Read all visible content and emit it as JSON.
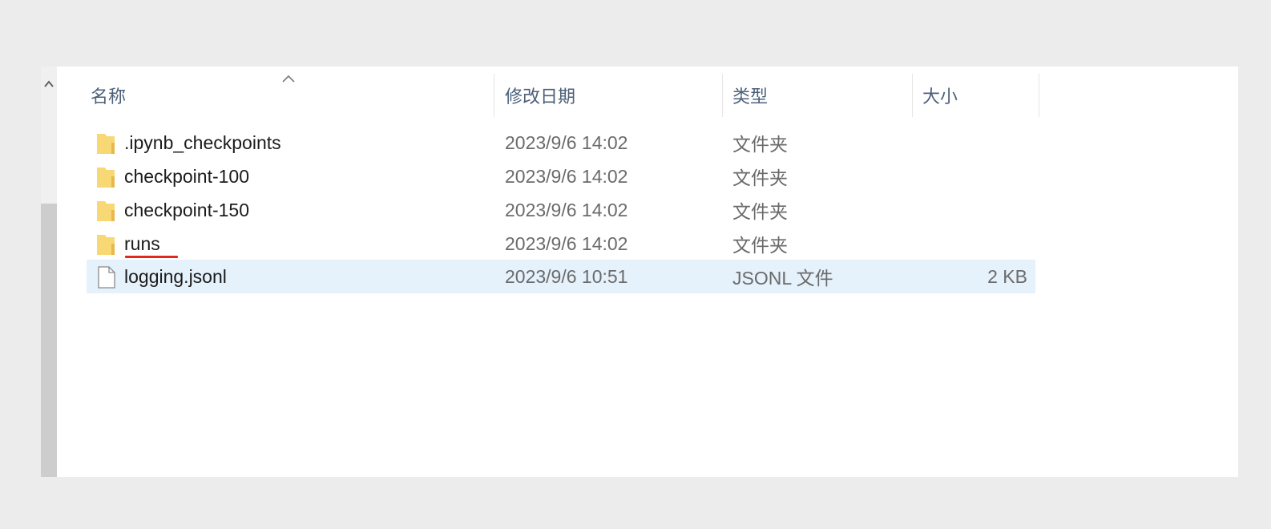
{
  "columns": {
    "name": "名称",
    "date": "修改日期",
    "type": "类型",
    "size": "大小"
  },
  "files": [
    {
      "name": ".ipynb_checkpoints",
      "date": "2023/9/6 14:02",
      "type": "文件夹",
      "size": "",
      "kind": "folder-icon"
    },
    {
      "name": "checkpoint-100",
      "date": "2023/9/6 14:02",
      "type": "文件夹",
      "size": "",
      "kind": "folder-icon"
    },
    {
      "name": "checkpoint-150",
      "date": "2023/9/6 14:02",
      "type": "文件夹",
      "size": "",
      "kind": "folder-icon"
    },
    {
      "name": "runs",
      "date": "2023/9/6 14:02",
      "type": "文件夹",
      "size": "",
      "kind": "folder-icon"
    },
    {
      "name": "logging.jsonl",
      "date": "2023/9/6 10:51",
      "type": "JSONL 文件",
      "size": "2 KB",
      "kind": "file-icon"
    }
  ],
  "colors": {
    "folder": "#f8d775",
    "selection": "#e5f1fb",
    "annotation": "#e0281c"
  }
}
